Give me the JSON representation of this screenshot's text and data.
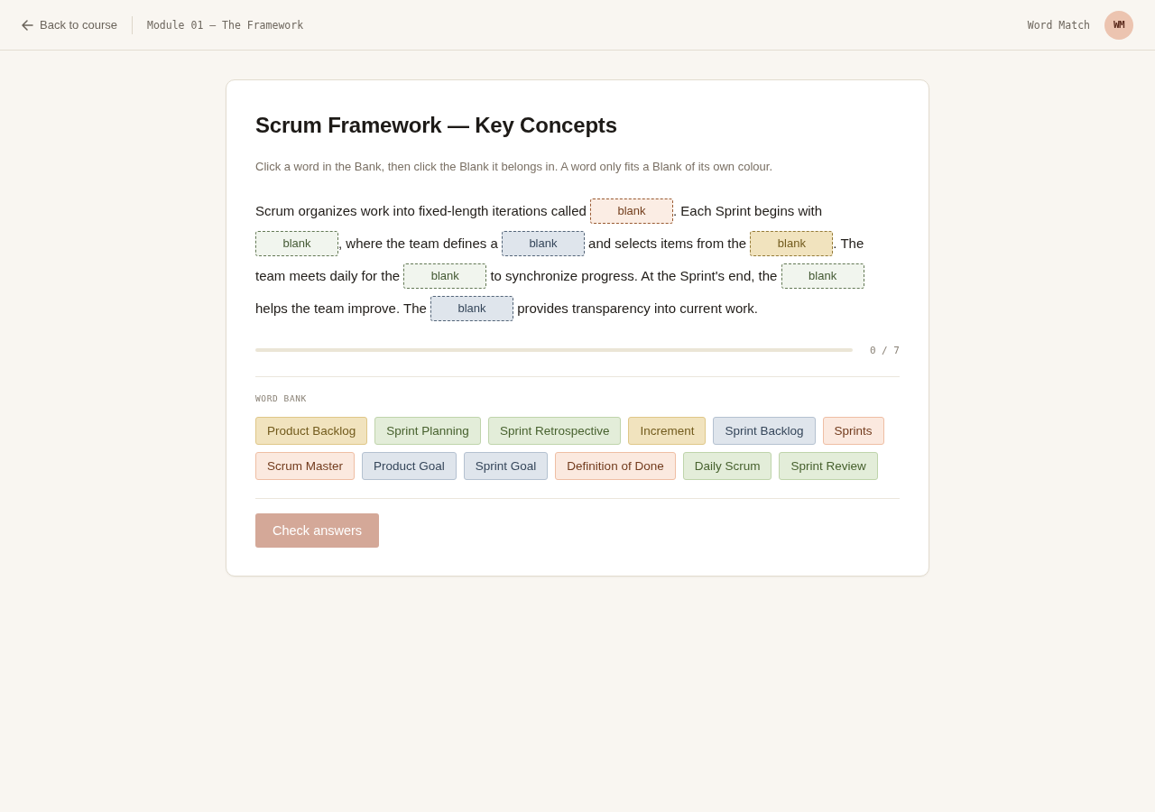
{
  "header": {
    "back_link": "Back to course",
    "breadcrumb": "Module 01 — The Framework",
    "app_name": "Word Match",
    "avatar_initials": "WM"
  },
  "exercise": {
    "title": "Scrum Framework — Key Concepts",
    "instructions": "Click a word in the Bank, then click the Blank it belongs in. A word only fits a Blank of its own colour.",
    "passage_lines": [
      [
        {
          "kind": "text",
          "text": "Scrum organizes work into fixed-length iterations called "
        },
        {
          "kind": "blank",
          "placeholder": "blank",
          "color": "#fbede4"
        },
        {
          "kind": "text",
          "text": ". Each Sprint begins with"
        }
      ],
      [
        {
          "kind": "blank",
          "placeholder": "blank",
          "color": "#f1f5ee"
        },
        {
          "kind": "text",
          "text": ", where the team defines a "
        },
        {
          "kind": "blank",
          "placeholder": "blank",
          "color": "#dfe5ec"
        },
        {
          "kind": "text",
          "text": " and selects items from the "
        },
        {
          "kind": "blank",
          "placeholder": "blank",
          "color": "#f1e3be"
        },
        {
          "kind": "text",
          "text": ". The"
        }
      ],
      [
        {
          "kind": "text",
          "text": "team meets daily for the "
        },
        {
          "kind": "blank",
          "placeholder": "blank",
          "color": "#f1f5ee"
        },
        {
          "kind": "text",
          "text": " to synchronize progress. At the Sprint's end, the "
        },
        {
          "kind": "blank",
          "placeholder": "blank",
          "color": "#f1f5ee"
        }
      ],
      [
        {
          "kind": "text",
          "text": "helps the team improve. The "
        },
        {
          "kind": "blank",
          "placeholder": "blank",
          "color": "#dfe5ec"
        },
        {
          "kind": "text",
          "text": " provides transparency into current work."
        }
      ]
    ],
    "progress": {
      "level": 0,
      "reading": "0 / 7"
    },
    "word_bank": {
      "label": "WORD BANK",
      "words": [
        {
          "text": "Product Backlog",
          "color": "#f1e3be"
        },
        {
          "text": "Sprint Planning",
          "color": "#e3edd9"
        },
        {
          "text": "Sprint Retrospective",
          "color": "#e3edd9"
        },
        {
          "text": "Increment",
          "color": "#f1e3be"
        },
        {
          "text": "Sprint Backlog",
          "color": "#dfe5ec"
        },
        {
          "text": "Sprints",
          "color": "#fbe9df"
        },
        {
          "text": "Scrum Master",
          "color": "#fbe9df"
        },
        {
          "text": "Product Goal",
          "color": "#dfe5ec"
        },
        {
          "text": "Sprint Goal",
          "color": "#dfe5ec"
        },
        {
          "text": "Definition of Done",
          "color": "#fbe9df"
        },
        {
          "text": "Daily Scrum",
          "color": "#e3edd9"
        },
        {
          "text": "Sprint Review",
          "color": "#e3edd9"
        }
      ]
    },
    "check_button": {
      "label": "Check answers",
      "disabled": true
    }
  }
}
